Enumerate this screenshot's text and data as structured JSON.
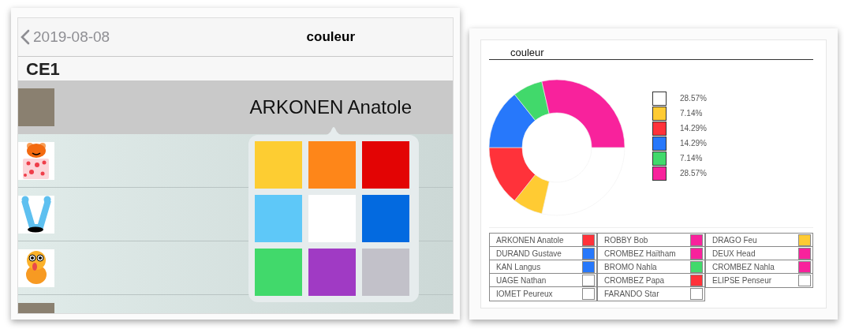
{
  "screen": {
    "back_label": "2019-08-08",
    "title": "couleur",
    "section": "CE1",
    "rows": [
      {
        "kind": "photo",
        "name": "ARKONEN Anatole",
        "selected": true
      },
      {
        "kind": "bear",
        "selected": false
      },
      {
        "kind": "snake",
        "selected": false
      },
      {
        "kind": "monster",
        "selected": false
      },
      {
        "kind": "photo",
        "selected": false
      }
    ],
    "palette": [
      {
        "color": "#fdcd32"
      },
      {
        "color": "#fe8619"
      },
      {
        "color": "#e30404"
      },
      {
        "color": "#5ec8f8"
      },
      {
        "color": "#ffffff"
      },
      {
        "color": "#036ae0"
      },
      {
        "color": "#41d96b"
      },
      {
        "color": "#a03ac4"
      },
      {
        "color": "#c2c1c9"
      }
    ]
  },
  "report": {
    "title": "couleur",
    "chart_data": {
      "type": "donut",
      "values": [
        28.57,
        7.14,
        14.29,
        14.29,
        7.14,
        28.57
      ],
      "value_labels": [
        "28.57%",
        "7.14%",
        "14.29%",
        "14.29%",
        "7.14%",
        "28.57%"
      ]
    },
    "legend": [
      {
        "color": "#ffffff"
      },
      {
        "color": "#ffcb33"
      },
      {
        "color": "#ff323a"
      },
      {
        "color": "#2778fb"
      },
      {
        "color": "#41d96b"
      },
      {
        "color": "#f8229c"
      }
    ],
    "table": {
      "columns": [
        [
          {
            "name": "ARKONEN Anatole",
            "color": "#ff323a"
          },
          {
            "name": "DURAND Gustave",
            "color": "#2778fb"
          },
          {
            "name": "KAN Langus",
            "color": "#2778fb"
          },
          {
            "name": "UAGE Nathan",
            "color": "#ffffff"
          },
          {
            "name": "IOMET Peureux",
            "color": "#ffffff"
          }
        ],
        [
          {
            "name": "ROBBY Bob",
            "color": "#f8229c"
          },
          {
            "name": "CROMBEZ Haïtham",
            "color": "#f8229c"
          },
          {
            "name": "BROMO Nahla",
            "color": "#41d96b"
          },
          {
            "name": "CROMBEZ Papa",
            "color": "#ff323a"
          },
          {
            "name": "FARANDO Star",
            "color": "#ffffff"
          }
        ],
        [
          {
            "name": "DRAGO Feu",
            "color": "#ffcb33"
          },
          {
            "name": "DEUX Head",
            "color": "#f8229c"
          },
          {
            "name": "CROMBEZ Nahla",
            "color": "#f8229c"
          },
          {
            "name": "ELIPSE Penseur",
            "color": "#ffffff"
          }
        ]
      ]
    }
  }
}
